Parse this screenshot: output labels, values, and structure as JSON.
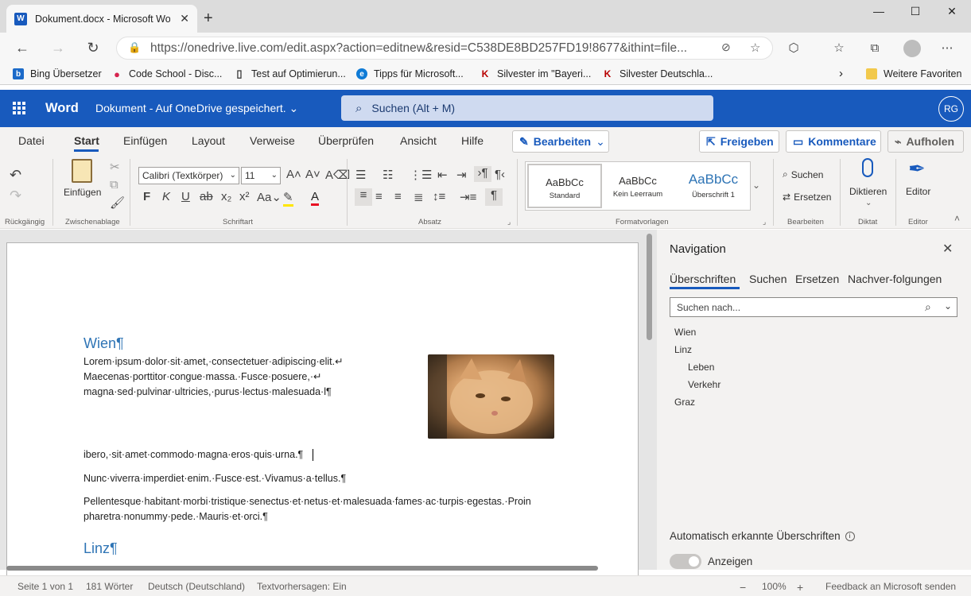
{
  "browser": {
    "tab_title": "Dokument.docx - Microsoft Word",
    "tab_icon": "W",
    "url": "https://onedrive.live.com/edit.aspx?action=editnew&resid=C538DE8BD257FD19!8677&ithint=file...",
    "favorites": [
      {
        "label": "Bing Übersetzer",
        "icon": "b",
        "color": "#1b6ac9"
      },
      {
        "label": "Code School - Disc...",
        "icon": "●",
        "color": "#d6244e"
      },
      {
        "label": "Test auf Optimierun...",
        "icon": "▯",
        "color": "#333333"
      },
      {
        "label": "Tipps für Microsoft...",
        "icon": "e",
        "color": "#0f7bd6"
      },
      {
        "label": "Silvester im \"Bayeri...",
        "icon": "K",
        "color": "#b80000"
      },
      {
        "label": "Silvester Deutschla...",
        "icon": "K",
        "color": "#b80000"
      }
    ],
    "favorites_more": "Weitere Favoriten"
  },
  "app": {
    "name": "Word",
    "doc_title": "Dokument  -  Auf OneDrive gespeichert. ⌄",
    "search_placeholder": "Suchen (Alt + M)",
    "avatar": "RG",
    "brand_color": "#185abd"
  },
  "ribbon": {
    "tabs": [
      "Datei",
      "Start",
      "Einfügen",
      "Layout",
      "Verweise",
      "Überprüfen",
      "Ansicht",
      "Hilfe"
    ],
    "active_tab": "Start",
    "edit_mode": "Bearbeiten",
    "share": "Freigeben",
    "comments": "Kommentare",
    "catch_up": "Aufholen",
    "paste": "Einfügen",
    "font_name": "Calibri (Textkörper)",
    "font_size": "11",
    "styles": [
      {
        "preview": "AaBbCc",
        "label": "Standard"
      },
      {
        "preview": "AaBbCc",
        "label": "Kein Leerraum"
      },
      {
        "preview": "AaBbCc",
        "label": "Überschrift 1"
      }
    ],
    "find": "Suchen",
    "replace": "Ersetzen",
    "dictate": "Diktieren",
    "editor": "Editor",
    "group_labels": {
      "undo": "Rückgängig",
      "clipboard": "Zwischenablage",
      "font": "Schriftart",
      "paragraph": "Absatz",
      "styles": "Formatvorlagen",
      "editing": "Bearbeiten",
      "dictate": "Diktat",
      "editor": "Editor"
    }
  },
  "document": {
    "heading1": "Wien¶",
    "para1": [
      "Lorem·ipsum·dolor·sit·amet,·consectetuer·adipiscing·elit.↵",
      "Maecenas·porttitor·congue·massa.·Fusce·posuere,·↵",
      "magna·sed·pulvinar·ultricies,·purus·lectus·malesuada·l¶"
    ],
    "para2": "ibero,·sit·amet·commodo·magna·eros·quis·urna.¶",
    "para3": "Nunc·viverra·imperdiet·enim.·Fusce·est.·Vivamus·a·tellus.¶",
    "para4": [
      "Pellentesque·habitant·morbi·tristique·senectus·et·netus·et·malesuada·fames·ac·turpis·egestas.·Proin",
      "pharetra·nonummy·pede.·Mauris·et·orci.¶"
    ],
    "heading2": "Linz¶"
  },
  "navigation": {
    "title": "Navigation",
    "tabs": [
      "Überschriften",
      "Suchen",
      "Ersetzen",
      "Nachver-folgungen"
    ],
    "active_tab": "Überschriften",
    "search_placeholder": "Suchen nach...",
    "headings": [
      {
        "label": "Wien",
        "level": 1
      },
      {
        "label": "Linz",
        "level": 1
      },
      {
        "label": "Leben",
        "level": 2
      },
      {
        "label": "Verkehr",
        "level": 2
      },
      {
        "label": "Graz",
        "level": 1
      }
    ],
    "auto_headings": "Automatisch erkannte Überschriften",
    "toggle_label": "Anzeigen"
  },
  "status": {
    "page": "Seite 1 von 1",
    "words": "181 Wörter",
    "language": "Deutsch (Deutschland)",
    "prediction": "Textvorhersagen: Ein",
    "zoom": "100%",
    "feedback": "Feedback an Microsoft senden"
  }
}
